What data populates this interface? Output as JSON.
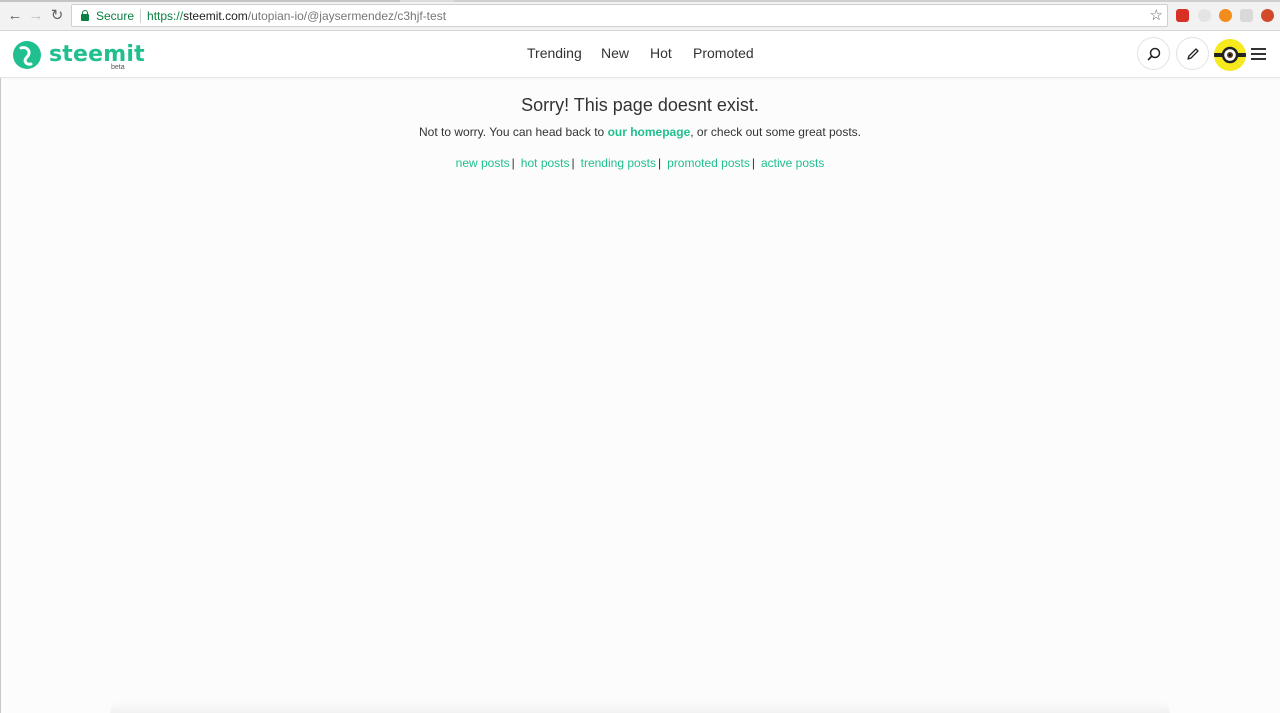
{
  "browser": {
    "security_label": "Secure",
    "url_scheme": "https://",
    "url_host": "steemit.com",
    "url_path": "/utopian-io/@jaysermendez/c3hjf-test"
  },
  "site": {
    "logo_text": "steemit",
    "logo_badge": "beta",
    "brand_color": "#1fbf8f",
    "nav": {
      "trending": "Trending",
      "new": "New",
      "hot": "Hot",
      "promoted": "Promoted"
    }
  },
  "error_page": {
    "title": "Sorry! This page doesnt exist.",
    "message_before": "Not to worry. You can head back to ",
    "homepage_link": "our homepage",
    "message_after": ", or check out some great posts.",
    "links": {
      "new": "new posts",
      "hot": "hot posts",
      "trending": "trending posts",
      "promoted": "promoted posts",
      "active": "active posts"
    },
    "separator": "|"
  }
}
